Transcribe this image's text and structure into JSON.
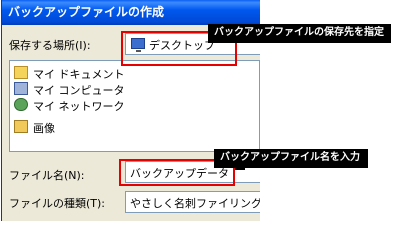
{
  "dialog": {
    "title": "バックアップファイルの作成",
    "save_in": {
      "label": "保存する場所(I):",
      "value": "デスクトップ"
    },
    "places": [
      {
        "label": "マイ ドキュメント",
        "icon": "my-documents-icon"
      },
      {
        "label": "マイ コンピュータ",
        "icon": "my-computer-icon"
      },
      {
        "label": "マイ ネットワーク",
        "icon": "my-network-icon"
      },
      {
        "label": "画像",
        "icon": "folder-icon"
      }
    ],
    "file_name": {
      "label": "ファイル名(N):",
      "value": "バックアップデータ"
    },
    "file_type": {
      "label": "ファイルの種類(T):",
      "value": "やさしく名刺ファイリング バックアップ"
    }
  },
  "annotations": {
    "location_note": "バックアップファイルの保存先を指定",
    "filename_note": "バックアップファイル名を入力",
    "highlight_color": "#e60000"
  }
}
